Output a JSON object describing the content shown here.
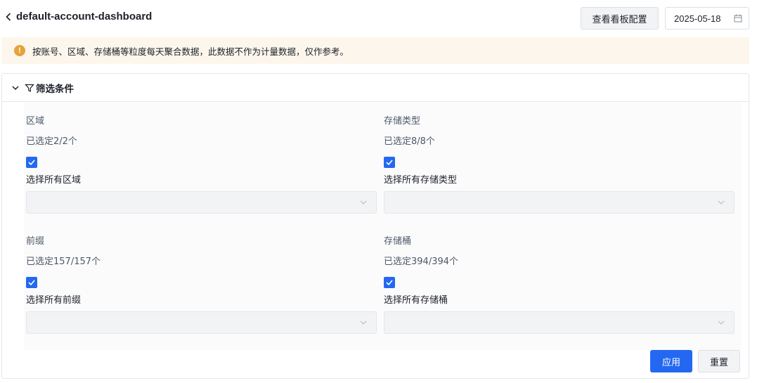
{
  "header": {
    "title": "default-account-dashboard",
    "config_button": "查看看板配置",
    "date": "2025-05-18"
  },
  "notice": {
    "icon": "warning-icon",
    "icon_glyph": "!",
    "text": "按账号、区域、存储桶等粒度每天聚合数据，此数据不作为计量数据，仅作参考。",
    "color": "#e6a23c"
  },
  "filter_panel": {
    "title": "筛选条件",
    "expanded": true,
    "groups": [
      {
        "label": "区域",
        "selected_count": "已选定2/2个",
        "select_all_checked": true,
        "select_all_label": "选择所有区域",
        "select_value": ""
      },
      {
        "label": "存储类型",
        "selected_count": "已选定8/8个",
        "select_all_checked": true,
        "select_all_label": "选择所有存储类型",
        "select_value": ""
      },
      {
        "label": "前缀",
        "selected_count": "已选定157/157个",
        "select_all_checked": true,
        "select_all_label": "选择所有前缀",
        "select_value": ""
      },
      {
        "label": "存储桶",
        "selected_count": "已选定394/394个",
        "select_all_checked": true,
        "select_all_label": "选择所有存储桶",
        "select_value": ""
      }
    ]
  },
  "actions": {
    "apply": "应用",
    "reset": "重置"
  },
  "colors": {
    "primary": "#2468f2",
    "warning_bg": "#fdf6ec"
  }
}
